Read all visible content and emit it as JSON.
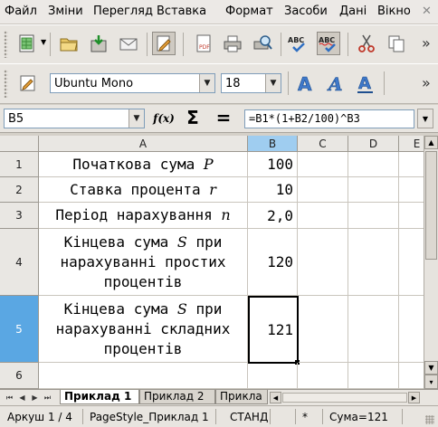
{
  "menu": {
    "items": [
      "Файл",
      "Зміни",
      "Перегляд",
      "Вставка",
      "Формат",
      "Засоби",
      "Дані",
      "Вікно"
    ],
    "close_glyph": "✕"
  },
  "toolbar_format": {
    "font_name": "Ubuntu Mono",
    "font_size": "18"
  },
  "formula_bar": {
    "cell_ref": "B5",
    "function_wizard_label": "f(x)",
    "sum_symbol": "Σ",
    "equals_symbol": "=",
    "formula": "=B1*(1+B2/100)^B3"
  },
  "grid": {
    "columns": [
      "A",
      "B",
      "C",
      "D",
      "E"
    ],
    "rows": [
      {
        "num": "1",
        "label": "Початкова сума ",
        "var": "P",
        "label_after": "",
        "value": "100"
      },
      {
        "num": "2",
        "label": "Ставка процента ",
        "var": "r",
        "label_after": "",
        "value": "10"
      },
      {
        "num": "3",
        "label": "Період нарахування ",
        "var": "n",
        "label_after": "",
        "value": "2,0"
      },
      {
        "num": "4",
        "label": "Кінцева сума ",
        "var": "S",
        "label_after": " при нарахуванні простих процентів",
        "value": "120"
      },
      {
        "num": "5",
        "label": "Кінцева сума ",
        "var": "S",
        "label_after": " при нарахуванні складних процентів",
        "value": "121"
      },
      {
        "num": "6",
        "label": "",
        "var": "",
        "label_after": "",
        "value": ""
      }
    ],
    "active_cell": "B5",
    "selected_column": "B",
    "selected_row": "5"
  },
  "sheet_tabs": [
    "Приклад 1",
    "Приклад 2",
    "Прикла"
  ],
  "status": {
    "sheet": "Аркуш 1 / 4",
    "page_style": "PageStyle_Приклад 1",
    "mode": "СТАНД",
    "modified": "*",
    "sum": "Сума=121"
  },
  "icons": {
    "accent": "#5aa7e3",
    "selection_header": "#9fcdf0"
  }
}
